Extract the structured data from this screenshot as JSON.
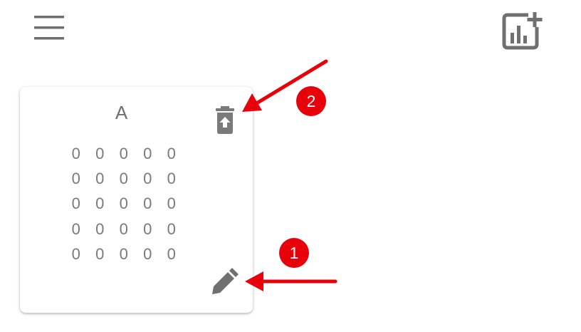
{
  "toolbar": {
    "menu_icon": "menu-icon",
    "add_chart_icon": "add-chart-icon"
  },
  "card": {
    "title": "A",
    "delete_icon": "delete-restore-icon",
    "edit_icon": "pencil-icon",
    "matrix": [
      [
        "0",
        "0",
        "0",
        "0",
        "0"
      ],
      [
        "0",
        "0",
        "0",
        "0",
        "0"
      ],
      [
        "0",
        "0",
        "0",
        "0",
        "0"
      ],
      [
        "0",
        "0",
        "0",
        "0",
        "0"
      ],
      [
        "0",
        "0",
        "0",
        "0",
        "0"
      ]
    ]
  },
  "annotations": {
    "badge_1": "1",
    "badge_2": "2",
    "color": "#e8000b"
  },
  "colors": {
    "icon": "#707070",
    "text": "#7a7a7a"
  }
}
